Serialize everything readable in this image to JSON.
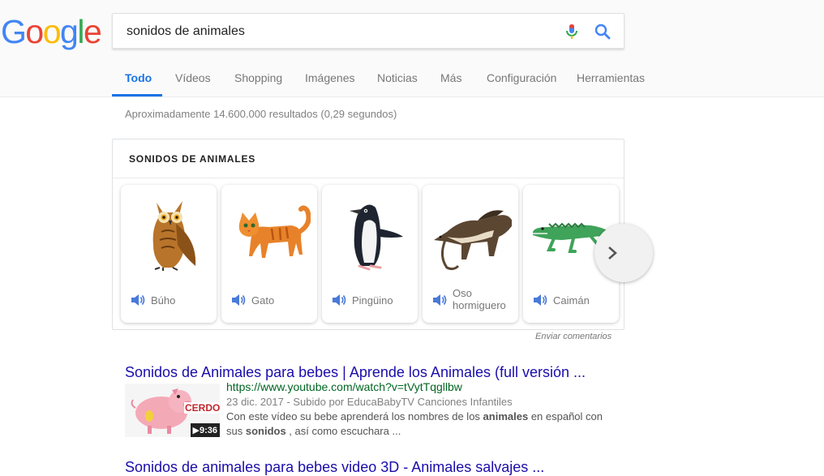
{
  "logo": {
    "letters": [
      "G",
      "o",
      "o",
      "g",
      "l",
      "e"
    ],
    "colors": [
      "#4285f4",
      "#ea4335",
      "#fbbc05",
      "#4285f4",
      "#34a853",
      "#ea4335"
    ]
  },
  "search": {
    "value": "sonidos de animales"
  },
  "tabs": [
    {
      "label": "Todo",
      "active": true
    },
    {
      "label": "Vídeos"
    },
    {
      "label": "Shopping"
    },
    {
      "label": "Imágenes"
    },
    {
      "label": "Noticias"
    },
    {
      "label": "Más"
    },
    {
      "label": "Configuración"
    },
    {
      "label": "Herramientas"
    }
  ],
  "stats": "Aproximadamente 14.600.000 resultados (0,29 segundos)",
  "card": {
    "title": "SONIDOS DE ANIMALES",
    "animals": [
      {
        "label": "Búho",
        "icon": "owl-icon"
      },
      {
        "label": "Gato",
        "icon": "cat-icon"
      },
      {
        "label": "Pingüino",
        "icon": "penguin-icon"
      },
      {
        "label": "Oso hormiguero",
        "line1": "Oso",
        "line2": "hormiguero",
        "icon": "anteater-icon"
      },
      {
        "label": "Caimán",
        "icon": "caiman-icon"
      }
    ],
    "feedback": "Enviar comentarios"
  },
  "results": [
    {
      "title": "Sonidos de Animales para bebes | Aprende los Animales (full versión ...",
      "url": "https://www.youtube.com/watch?v=tVytTqgllbw",
      "meta": "23 dic. 2017 - Subido por EducaBabyTV Canciones Infantiles",
      "snippet_parts": [
        "Con este vídeo su bebe aprenderá los nombres de los ",
        "animales",
        " en español con sus ",
        "sonidos",
        " , así como escuchara ..."
      ],
      "thumb_label": "CERDO",
      "duration": "▶9:36"
    },
    {
      "title": "Sonidos de animales para bebes video 3D - Animales salvajes ..."
    }
  ],
  "colors": {
    "link": "#1a0dab",
    "url": "#006621",
    "accent": "#1a73e8"
  }
}
